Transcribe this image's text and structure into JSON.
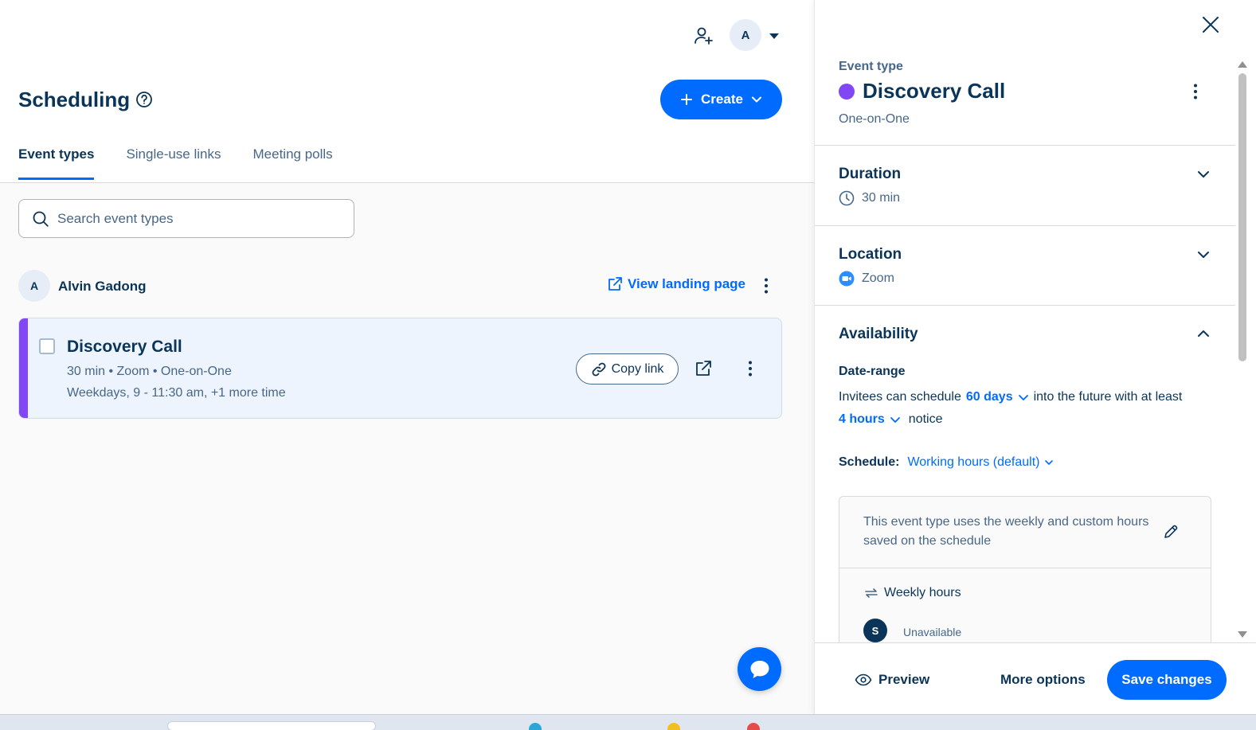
{
  "header": {
    "avatar_initial": "A",
    "page_title": "Scheduling",
    "create_label": "Create"
  },
  "tabs": [
    {
      "label": "Event types",
      "active": true
    },
    {
      "label": "Single-use links",
      "active": false
    },
    {
      "label": "Meeting polls",
      "active": false
    }
  ],
  "search": {
    "placeholder": "Search event types",
    "value": ""
  },
  "user": {
    "initial": "A",
    "name": "Alvin Gadong",
    "landing_label": "View landing page"
  },
  "event_card": {
    "title": "Discovery Call",
    "meta": "30 min • Zoom • One-on-One",
    "hours": "Weekdays, 9 - 11:30 am, +1 more time",
    "copy_label": "Copy link",
    "color": "#8247f5"
  },
  "panel": {
    "label": "Event type",
    "event_name": "Discovery Call",
    "event_kind": "One-on-One",
    "dot_color": "#8247f5",
    "duration": {
      "title": "Duration",
      "value": "30 min"
    },
    "location": {
      "title": "Location",
      "value": "Zoom"
    },
    "availability": {
      "title": "Availability",
      "date_range_label": "Date-range",
      "invitee_prefix": "Invitees can schedule",
      "days_value": "60 days",
      "invitee_middle": "into the future with at least",
      "notice_value": "4 hours",
      "invitee_suffix": "notice",
      "schedule_label": "Schedule:",
      "schedule_value": "Working hours (default)",
      "schedule_note": "This event type uses the weekly and custom hours saved on the schedule",
      "weekly_label": "Weekly hours",
      "day_initial": "S",
      "day_status": "Unavailable"
    },
    "footer": {
      "preview_label": "Preview",
      "more_label": "More options",
      "save_label": "Save changes"
    }
  },
  "colors": {
    "accent": "#006bff",
    "text": "#0b3558",
    "muted": "#476788"
  }
}
